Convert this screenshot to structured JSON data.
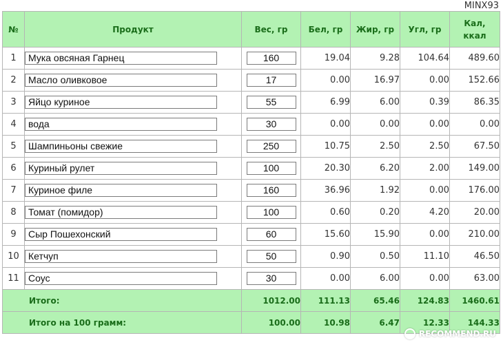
{
  "user_tag": "MINX93",
  "columns": [
    "№",
    "Продукт",
    "Вес, гр",
    "Бел, гр",
    "Жир, гр",
    "Угл, гр",
    "Кал,\nккал"
  ],
  "rows": [
    {
      "idx": "1",
      "name": "Мука овсяная Гарнец",
      "weight": "160",
      "protein": "19.04",
      "fat": "9.28",
      "carbs": "104.64",
      "kcal": "489.60"
    },
    {
      "idx": "2",
      "name": "Масло оливковое",
      "weight": "17",
      "protein": "0.00",
      "fat": "16.97",
      "carbs": "0.00",
      "kcal": "152.66"
    },
    {
      "idx": "3",
      "name": "Яйцо куриное",
      "weight": "55",
      "protein": "6.99",
      "fat": "6.00",
      "carbs": "0.39",
      "kcal": "86.35"
    },
    {
      "idx": "4",
      "name": "вода",
      "weight": "30",
      "protein": "0.00",
      "fat": "0.00",
      "carbs": "0.00",
      "kcal": "0.00"
    },
    {
      "idx": "5",
      "name": "Шампиньоны свежие",
      "weight": "250",
      "protein": "10.75",
      "fat": "2.50",
      "carbs": "2.50",
      "kcal": "67.50"
    },
    {
      "idx": "6",
      "name": "Куриный рулет",
      "weight": "100",
      "protein": "20.30",
      "fat": "6.20",
      "carbs": "2.00",
      "kcal": "149.00"
    },
    {
      "idx": "7",
      "name": "Куриное филе",
      "weight": "160",
      "protein": "36.96",
      "fat": "1.92",
      "carbs": "0.00",
      "kcal": "176.00"
    },
    {
      "idx": "8",
      "name": "Томат (помидор)",
      "weight": "100",
      "protein": "0.60",
      "fat": "0.20",
      "carbs": "4.20",
      "kcal": "20.00"
    },
    {
      "idx": "9",
      "name": "Сыр Пошехонский",
      "weight": "60",
      "protein": "15.60",
      "fat": "15.90",
      "carbs": "0.00",
      "kcal": "210.00"
    },
    {
      "idx": "10",
      "name": "Кетчуп",
      "weight": "50",
      "protein": "0.90",
      "fat": "0.50",
      "carbs": "11.10",
      "kcal": "46.50"
    },
    {
      "idx": "11",
      "name": "Соус",
      "weight": "30",
      "protein": "0.00",
      "fat": "6.00",
      "carbs": "0.00",
      "kcal": "63.00"
    }
  ],
  "totals": {
    "label": "Итого:",
    "weight": "1012.00",
    "protein": "111.13",
    "fat": "65.46",
    "carbs": "124.83",
    "kcal": "1460.61"
  },
  "per100": {
    "label": "Итого на 100 грамм:",
    "weight": "100.00",
    "protein": "10.98",
    "fat": "6.47",
    "carbs": "12.33",
    "kcal": "144.33"
  },
  "watermark": "RECOMMEND.RU",
  "colors": {
    "header_bg": "#b3f2b3",
    "header_text": "#1a6d1a",
    "border": "#b5b5b5"
  }
}
